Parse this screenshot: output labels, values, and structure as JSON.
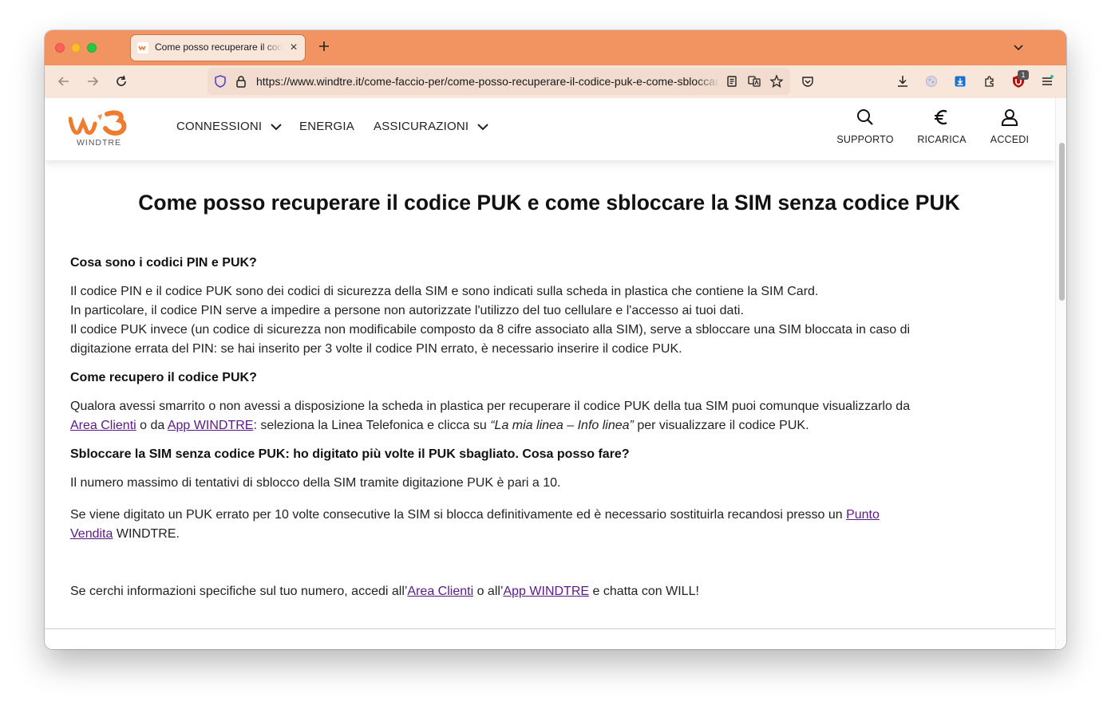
{
  "browser": {
    "tab_title": "Come posso recuperare il codice PUK e come sbloccare la SIM senza codice PUK",
    "url": "https://www.windtre.it/come-faccio-per/come-posso-recuperare-il-codice-puk-e-come-sbloccare-la-sim-senza-codice-puk/",
    "extension_badge": "1",
    "theme_color": "#f29461"
  },
  "site": {
    "logo_text": "WINDTRE",
    "nav": [
      "CONNESSIONI",
      "ENERGIA",
      "ASSICURAZIONI"
    ],
    "utilities": [
      "SUPPORTO",
      "RICARICA",
      "ACCEDI"
    ],
    "brand_color": "#f07a2e"
  },
  "article": {
    "title": "Come posso recuperare il codice PUK e come sbloccare la SIM senza codice PUK",
    "h1": "Cosa sono i codici PIN e PUK?",
    "p1_l1": "Il codice PIN e il codice PUK sono dei codici di sicurezza della SIM e sono indicati sulla scheda in plastica che contiene la SIM Card.",
    "p1_l2": "In particolare, il codice PIN serve a impedire a persone non autorizzate l'utilizzo del tuo cellulare e l'accesso ai tuoi dati.",
    "p1_l3": "Il codice PUK invece (un codice di sicurezza non modificabile composto da 8 cifre associato alla SIM), serve a sbloccare una SIM bloccata in caso di",
    "p1_l4": "digitazione errata del PIN: se hai inserito per 3 volte il codice PIN errato, è necessario inserire il codice PUK.",
    "h2": "Come recupero il codice PUK?",
    "p2_l1": "Qualora avessi smarrito o non avessi a disposizione la scheda in plastica per recuperare il codice PUK della tua SIM puoi comunque visualizzarlo da",
    "p2_link1": "Area Clienti",
    "p2_mid1": " o da ",
    "p2_link2": "App WINDTRE",
    "p2_mid2": ": seleziona la Linea Telefonica e clicca su ",
    "p2_ital": "“La mia linea – Info linea”",
    "p2_end": " per visualizzare il codice PUK.",
    "h3": "Sbloccare la SIM senza codice PUK: ho digitato più volte il PUK sbagliato. Cosa posso fare?",
    "p3": "Il numero massimo di tentativi di sblocco della SIM tramite digitazione PUK è pari a 10.",
    "p4_l1": "Se viene digitato un PUK errato per 10 volte consecutive la SIM si blocca definitivamente ed è necessario sostituirla recandosi presso un ",
    "p4_link_a": "Punto",
    "p4_link_b": "Vendita",
    "p4_end": " WINDTRE.",
    "p5_start": "Se cerchi informazioni specifiche sul tuo numero, accedi all’",
    "p5_link1": "Area Clienti",
    "p5_mid": " o all’",
    "p5_link2": "App WINDTRE",
    "p5_end": " e chatta con WILL!"
  }
}
